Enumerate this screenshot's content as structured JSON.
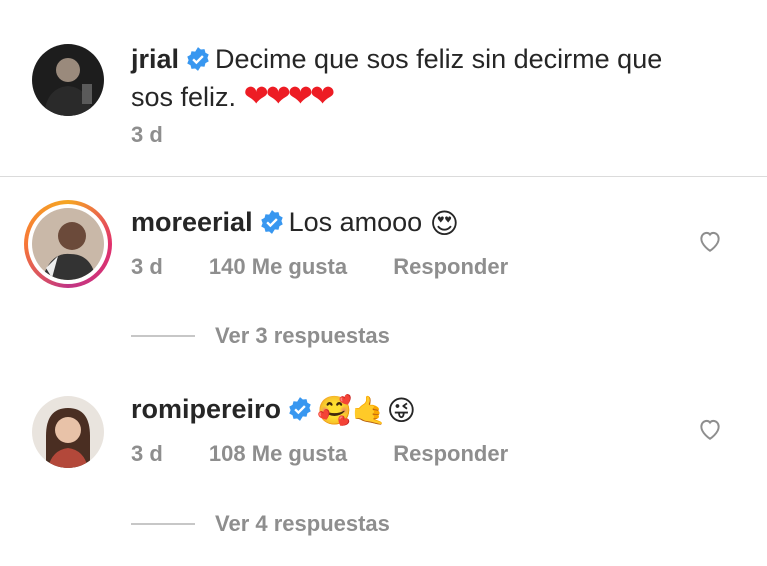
{
  "caption": {
    "username": "jrial",
    "text_line1": "Decime que sos feliz sin decirme que",
    "text_line2": "sos feliz.",
    "hearts": "❤❤❤❤",
    "time": "3 d"
  },
  "comments": [
    {
      "username": "moreerial",
      "text": "Los amooo",
      "emoji": "😍",
      "time": "3 d",
      "likes": "140 Me gusta",
      "reply_label": "Responder",
      "view_replies": "Ver 3 respuestas"
    },
    {
      "username": "romipereiro",
      "emoji": "🥰🤙😜",
      "time": "3 d",
      "likes": "108 Me gusta",
      "reply_label": "Responder",
      "view_replies": "Ver 4 respuestas"
    }
  ],
  "colors": {
    "verified": "#3897f0",
    "secondary_text": "#8e8e8e",
    "divider": "#dbdbdb",
    "heart": "#ed1c24"
  }
}
